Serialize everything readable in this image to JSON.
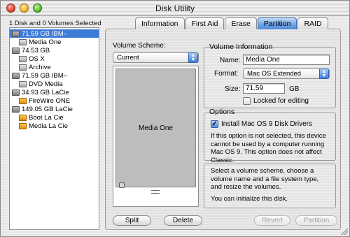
{
  "window": {
    "title": "Disk Utility"
  },
  "status_text": "1 Disk and 0 Volumes Selected",
  "disks": [
    {
      "label": "71.59 GB IBM–",
      "kind": "disk",
      "icon": "hard-disk-icon",
      "level": 0,
      "selected": true
    },
    {
      "label": "Media One",
      "kind": "volume",
      "icon": "volume-icon",
      "level": 1,
      "selected": false
    },
    {
      "label": "74.53 GB",
      "kind": "disk",
      "icon": "hard-disk-icon",
      "level": 0,
      "selected": false
    },
    {
      "label": "OS X",
      "kind": "volume",
      "icon": "volume-icon",
      "level": 1,
      "selected": false
    },
    {
      "label": "Archive",
      "kind": "volume",
      "icon": "volume-icon",
      "level": 1,
      "selected": false
    },
    {
      "label": "71.59 GB IBM–",
      "kind": "disk",
      "icon": "hard-disk-icon",
      "level": 0,
      "selected": false
    },
    {
      "label": "DVD Media",
      "kind": "volume",
      "icon": "volume-icon",
      "level": 1,
      "selected": false
    },
    {
      "label": "34.93 GB LaCie",
      "kind": "disk",
      "icon": "hard-disk-icon",
      "level": 0,
      "selected": false
    },
    {
      "label": "FireWire ONE",
      "kind": "volume",
      "icon": "firewire-volume-icon",
      "level": 1,
      "selected": false
    },
    {
      "label": "149.05 GB LaCie",
      "kind": "disk",
      "icon": "hard-disk-icon",
      "level": 0,
      "selected": false
    },
    {
      "label": "Boot La Cie",
      "kind": "volume",
      "icon": "firewire-volume-icon",
      "level": 1,
      "selected": false
    },
    {
      "label": "Media La Cie",
      "kind": "volume",
      "icon": "firewire-volume-icon",
      "level": 1,
      "selected": false
    }
  ],
  "tabs": [
    {
      "label": "Information",
      "active": false
    },
    {
      "label": "First Aid",
      "active": false
    },
    {
      "label": "Erase",
      "active": false
    },
    {
      "label": "Partition",
      "active": true
    },
    {
      "label": "RAID",
      "active": false
    }
  ],
  "partition": {
    "scheme_label": "Volume Scheme:",
    "scheme_value": "Current",
    "partition_name": "Media One",
    "split_label": "Split",
    "delete_label": "Delete"
  },
  "volume_info": {
    "group_title": "Volume Information",
    "name_label": "Name:",
    "name_value": "Media One",
    "format_label": "Format:",
    "format_value": "Mac OS Extended",
    "size_label": "Size:",
    "size_value": "71.59",
    "size_unit": "GB",
    "locked_label": "Locked for editing",
    "locked_checked": false
  },
  "options": {
    "group_title": "Options",
    "install_label": "Install Mac OS 9 Disk Drivers",
    "install_checked": true,
    "description": "If this option is not selected, this device cannot be used by a computer running Mac OS 9.  This option does not affect Classic."
  },
  "help": {
    "line1": "Select a volume scheme, choose a volume name and a file system type, and resize the volumes.",
    "line2": "You can initialize this disk."
  },
  "buttons": {
    "revert": "Revert",
    "partition": "Partition"
  },
  "colors": {
    "accent": "#3d7bd8",
    "tab_active": "#6fa4e6"
  }
}
